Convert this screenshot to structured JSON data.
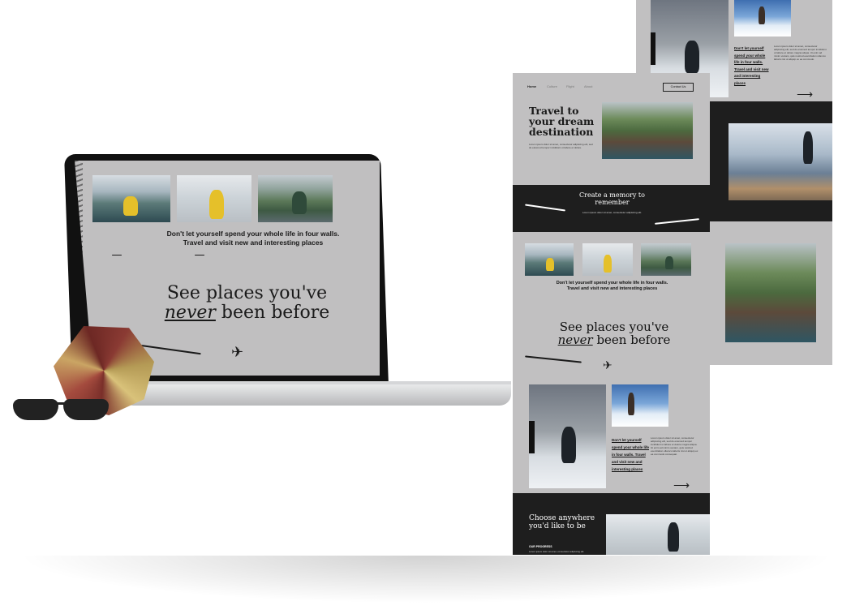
{
  "laptop": {
    "tagline_line1": "Don't let yourself spend your whole life in four walls.",
    "tagline_line2": "Travel and visit new and interesting places",
    "headline_pre": "See places you've",
    "headline_emph": "never",
    "headline_post": " been before"
  },
  "front_page": {
    "nav": {
      "home": "Home",
      "item2": "Culture",
      "item3": "Flight",
      "item4": "About",
      "contact": "Contact Us"
    },
    "hero_title": "Travel to your dream destination",
    "memory_title": "Create a memory to remember",
    "tagline_line1": "Don't let yourself spend your whole life in four walls.",
    "tagline_line2": "Travel and visit new and interesting places",
    "headline_pre": "See places you've",
    "headline_emph": "never",
    "headline_post": " been before",
    "links": "Don't let yourself spend your whole life in four walls. Travel and visit new and interesting places",
    "choose_title": "Choose anywhere you'd like to be",
    "progress_label": "OUR PROGRESS"
  },
  "back_page": {
    "links": "Don't let yourself spend your whole life in four walls. Travel and visit new and interesting places"
  }
}
